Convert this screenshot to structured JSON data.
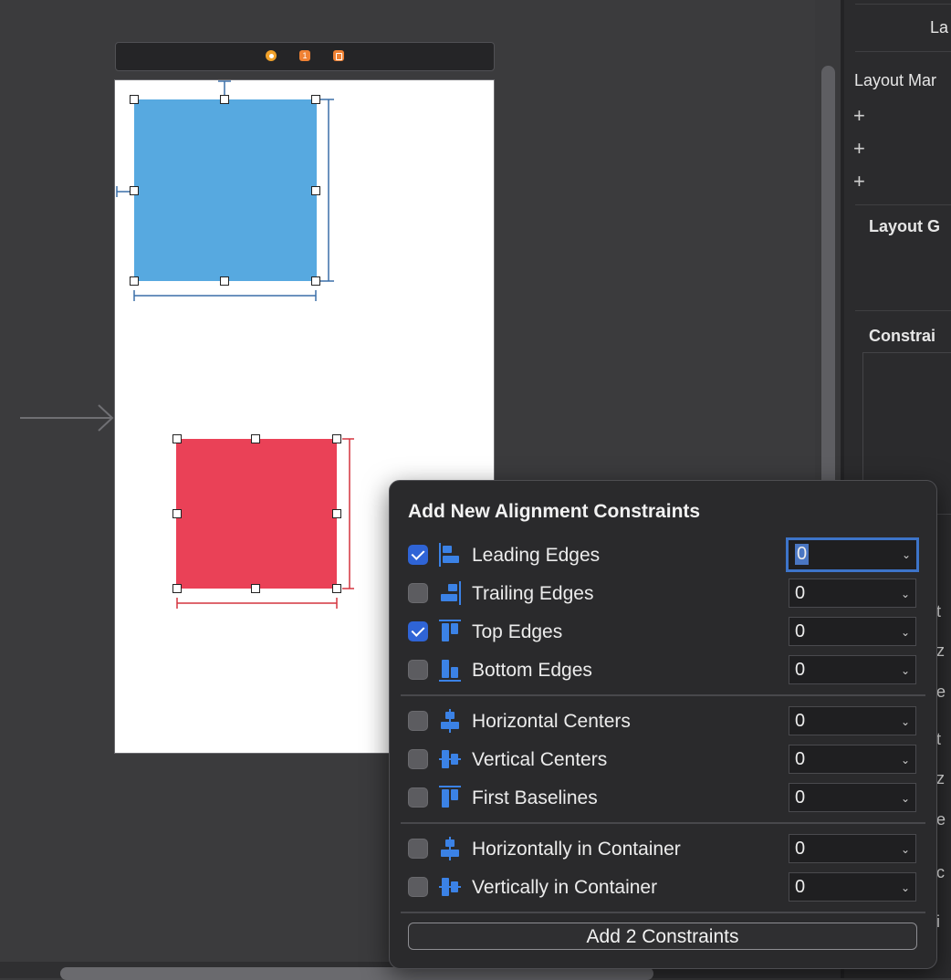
{
  "canvas": {
    "blue_view_color": "#57a9e0",
    "red_view_color": "#ea4157",
    "constraint_blue": "#3a6fa8",
    "constraint_red": "#d4343f"
  },
  "inspector": {
    "label_la": "La",
    "layout_margins": "Layout Mar",
    "plus": "+",
    "layout_guides": "Layout G",
    "constraints": "Constrai",
    "frag_t1": "t",
    "frag_z1": "z",
    "frag_e1": "e",
    "frag_t2": "t",
    "frag_z2": "z",
    "frag_e2": "e",
    "frag_c": "c",
    "frag_i": "i"
  },
  "popover": {
    "title": "Add New Alignment Constraints",
    "rows": [
      {
        "label": "Leading Edges",
        "checked": true,
        "value": "0",
        "icon": "leading-edges-icon"
      },
      {
        "label": "Trailing Edges",
        "checked": false,
        "value": "0",
        "icon": "trailing-edges-icon"
      },
      {
        "label": "Top Edges",
        "checked": true,
        "value": "0",
        "icon": "top-edges-icon"
      },
      {
        "label": "Bottom Edges",
        "checked": false,
        "value": "0",
        "icon": "bottom-edges-icon"
      },
      {
        "label": "Horizontal Centers",
        "checked": false,
        "value": "0",
        "icon": "horizontal-centers-icon"
      },
      {
        "label": "Vertical Centers",
        "checked": false,
        "value": "0",
        "icon": "vertical-centers-icon"
      },
      {
        "label": "First Baselines",
        "checked": false,
        "value": "0",
        "icon": "first-baselines-icon"
      },
      {
        "label": "Horizontally in Container",
        "checked": false,
        "value": "0",
        "icon": "horizontally-in-container-icon"
      },
      {
        "label": "Vertically in Container",
        "checked": false,
        "value": "0",
        "icon": "vertically-in-container-icon"
      }
    ],
    "add_button": "Add 2 Constraints",
    "icon_color": "#3b82e6"
  }
}
